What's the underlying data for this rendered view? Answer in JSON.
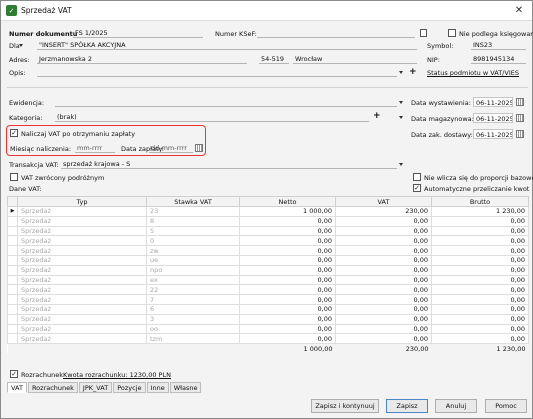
{
  "window": {
    "title": "Sprzedaż VAT"
  },
  "header": {
    "doc_number_label": "Numer dokumentu",
    "doc_number_value": "FS 1/2025",
    "ksef_label": "Numer KSeF:",
    "ksef_value": "",
    "not_booked_label": "Nie podlega księgowaniu",
    "for_label": "Dla",
    "for_value": "\"INSERT\" SPÓŁKA AKCYJNA",
    "symbol_label": "Symbol:",
    "symbol_value": "INS23",
    "address_label": "Adres:",
    "address_street": "Jerzmanowska 2",
    "address_zip": "54-519",
    "address_city": "Wrocław",
    "nip_label": "NIP:",
    "nip_value": "8981945134",
    "description_label": "Opis:",
    "vat_status_link": "Status podmiotu w VAT/VIES"
  },
  "meta": {
    "registry_label": "Ewidencja:",
    "category_label": "Kategoria:",
    "category_value": "(brak)",
    "issue_date_label": "Data wystawienia:",
    "issue_date_value": "06-11-2025",
    "warehouse_date_label": "Data magazynowa:",
    "warehouse_date_value": "06-11-2025",
    "delivery_date_label": "Data zak. dostawy:",
    "delivery_date_value": "06-11-2025"
  },
  "cash_vat": {
    "checkbox_label": "Naliczaj VAT po otrzymaniu zapłaty",
    "checked": true,
    "month_label": "Miesiąc naliczenia:",
    "month_placeholder": "mm-rrrr",
    "payment_date_label": "Data zapłaty:",
    "payment_date_placeholder": "dd-mm-rrrr"
  },
  "transaction": {
    "label": "Transakcja VAT:",
    "value": "sprzedaż krajowa - S",
    "traveler_refund_label": "VAT zwrócony podróżnym",
    "exclude_proportion_label": "Nie wlicza się do proporcji bazowej",
    "auto_recalc_label": "Automatyczne przeliczanie kwot",
    "vat_data_label": "Dane VAT:"
  },
  "table": {
    "columns": [
      "Typ",
      "Stawka VAT",
      "Netto",
      "VAT",
      "Brutto"
    ],
    "rows": [
      [
        "Sprzedaż",
        "23",
        "1 000,00",
        "230,00",
        "1 230,00"
      ],
      [
        "Sprzedaż",
        "8",
        "0,00",
        "0,00",
        "0,00"
      ],
      [
        "Sprzedaż",
        "5",
        "0,00",
        "0,00",
        "0,00"
      ],
      [
        "Sprzedaż",
        "0",
        "0,00",
        "0,00",
        "0,00"
      ],
      [
        "Sprzedaż",
        "zw",
        "0,00",
        "0,00",
        "0,00"
      ],
      [
        "Sprzedaż",
        "ue",
        "0,00",
        "0,00",
        "0,00"
      ],
      [
        "Sprzedaż",
        "npo",
        "0,00",
        "0,00",
        "0,00"
      ],
      [
        "Sprzedaż",
        "ex",
        "0,00",
        "0,00",
        "0,00"
      ],
      [
        "Sprzedaż",
        "22",
        "0,00",
        "0,00",
        "0,00"
      ],
      [
        "Sprzedaż",
        "7",
        "0,00",
        "0,00",
        "0,00"
      ],
      [
        "Sprzedaż",
        "6",
        "0,00",
        "0,00",
        "0,00"
      ],
      [
        "Sprzedaż",
        "3",
        "0,00",
        "0,00",
        "0,00"
      ],
      [
        "Sprzedaż",
        "oo",
        "0,00",
        "0,00",
        "0,00"
      ],
      [
        "Sprzedaż",
        "tzm",
        "0,00",
        "0,00",
        "0,00"
      ]
    ],
    "totals": [
      "1 000,00",
      "230,00",
      "1 230,00"
    ]
  },
  "settlement": {
    "checkbox_label": "Rozrachunek",
    "amount_link": "Kwota rozrachunku: 1230,00 PLN"
  },
  "tabs": [
    "VAT",
    "Rozrachunek",
    "JPK_VAT",
    "Pozycje",
    "Inne",
    "Własne"
  ],
  "buttons": {
    "save_continue": "Zapisz i kontynuuj",
    "save": "Zapisz",
    "cancel": "Anuluj",
    "help": "Pomoc"
  },
  "colors": {
    "highlight": "#e33333",
    "app_icon": "#2e7d32"
  }
}
